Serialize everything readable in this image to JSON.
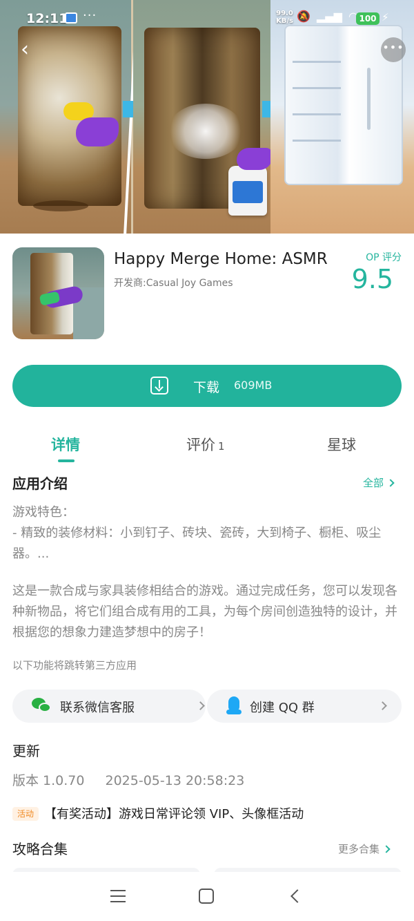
{
  "status_bar": {
    "time": "12:11",
    "dots": "···",
    "speed_value": "99.0",
    "speed_unit": "KB/s",
    "battery": "100"
  },
  "hero": {
    "back_icon": "chevron-left-icon",
    "more_icon": "more-dots-icon"
  },
  "app": {
    "name": "Happy Merge Home: ASMR",
    "developer": "开发商:Casual Joy Games",
    "score_label": "OP 评分",
    "score": "9.5"
  },
  "download": {
    "label": "下载",
    "size": "609MB",
    "color": "#22b39c"
  },
  "tabs": [
    {
      "label": "详情",
      "active": true
    },
    {
      "label": "评价",
      "count": "1"
    },
    {
      "label": "星球"
    }
  ],
  "intro": {
    "title": "应用介绍",
    "more": "全部",
    "feature_heading": "游戏特色：",
    "feature_line": "- 精致的装修材料：小到钉子、砖块、瓷砖，大到椅子、橱柜、吸尘器。...",
    "description": "这是一款合成与家具装修相结合的游戏。通过完成任务，您可以发现各种新物品，将它们组合成有用的工具，为每个房间创造独特的设计，并根据您的想象力建造梦想中的房子！",
    "third_party_note": "以下功能将跳转第三方应用"
  },
  "links": {
    "wechat": "联系微信客服",
    "qq": "创建 QQ 群"
  },
  "update": {
    "title": "更新",
    "version": "版本 1.0.70",
    "date": "2025-05-13 20:58:23",
    "event_badge": "活动",
    "event_text": "【有奖活动】游戏日常评论领 VIP、头像框活动"
  },
  "guides": {
    "title": "攻略合集",
    "more": "更多合集"
  },
  "colors": {
    "accent": "#25b59e",
    "event": "#f08a24"
  }
}
